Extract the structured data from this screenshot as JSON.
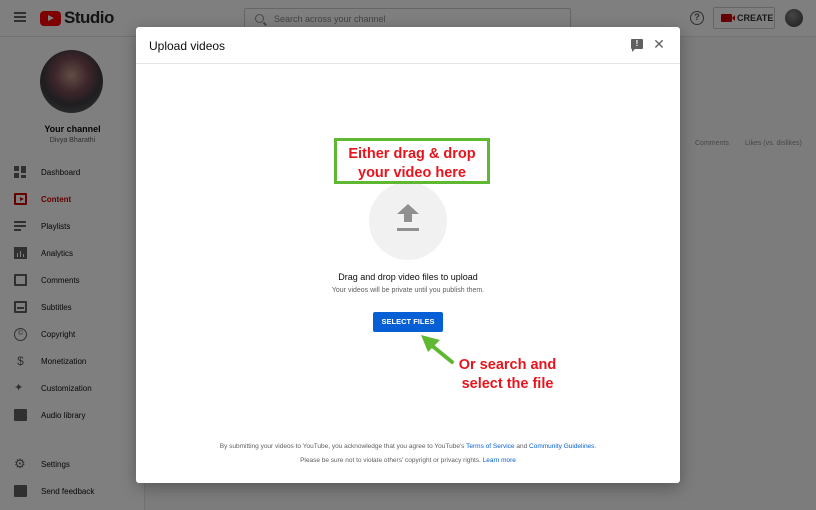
{
  "header": {
    "logo_text": "Studio",
    "search_placeholder": "Search across your channel",
    "help_icon_glyph": "?",
    "create_label": "CREATE"
  },
  "sidebar": {
    "channel_title": "Your channel",
    "channel_name": "Divya Bharathi",
    "items": [
      {
        "label": "Dashboard",
        "icon": "dashboard-icon"
      },
      {
        "label": "Content",
        "icon": "content-icon",
        "active": true
      },
      {
        "label": "Playlists",
        "icon": "playlists-icon"
      },
      {
        "label": "Analytics",
        "icon": "analytics-icon"
      },
      {
        "label": "Comments",
        "icon": "comments-icon"
      },
      {
        "label": "Subtitles",
        "icon": "subtitles-icon"
      },
      {
        "label": "Copyright",
        "icon": "copyright-icon"
      },
      {
        "label": "Monetization",
        "icon": "monetization-icon"
      },
      {
        "label": "Customization",
        "icon": "customization-icon"
      },
      {
        "label": "Audio library",
        "icon": "audio-library-icon"
      }
    ],
    "bottom_items": [
      {
        "label": "Settings",
        "icon": "settings-icon"
      },
      {
        "label": "Send feedback",
        "icon": "send-feedback-icon"
      }
    ]
  },
  "background_table": {
    "columns": [
      "Comments",
      "Likes (vs. dislikes)"
    ]
  },
  "dialog": {
    "title": "Upload videos",
    "drag_title": "Drag and drop video files to upload",
    "drag_subtitle": "Your videos will be private until you publish them.",
    "select_button": "SELECT FILES",
    "terms_prefix": "By submitting your videos to YouTube, you acknowledge that you agree to YouTube's",
    "terms_link": "Terms of Service",
    "terms_and": "and",
    "guidelines_link": "Community Guidelines",
    "terms_suffix": ".",
    "rights_text": "Please be sure not to violate others' copyright or privacy rights.",
    "learn_more": "Learn more"
  },
  "annotations": {
    "drag_note_line1": "Either drag & drop",
    "drag_note_line2": "your video here",
    "search_note_line1": "Or search and",
    "search_note_line2": "select the file"
  },
  "colors": {
    "accent_red": "#cc0000",
    "button_blue": "#065fd4",
    "annotation_red": "#e8141d",
    "annotation_green": "#5fb832"
  }
}
